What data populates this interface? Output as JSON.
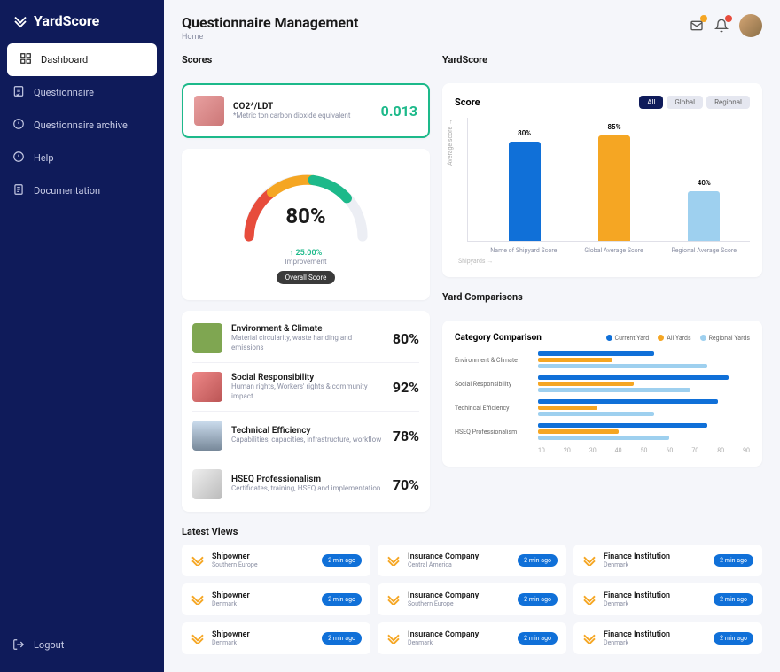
{
  "brand": "YardScore",
  "nav": {
    "items": [
      {
        "label": "Dashboard",
        "active": true
      },
      {
        "label": "Questionnaire",
        "active": false
      },
      {
        "label": "Questionnaire archive",
        "active": false
      },
      {
        "label": "Help",
        "active": false
      },
      {
        "label": "Documentation",
        "active": false
      }
    ],
    "logout": "Logout"
  },
  "header": {
    "title": "Questionnaire Management",
    "breadcrumb": "Home"
  },
  "sections": {
    "scores": "Scores",
    "yardscore": "YardScore",
    "comparisons": "Yard Comparisons",
    "latest_views": "Latest Views"
  },
  "co2": {
    "title": "CO2*/LDT",
    "sub": "*Metric ton carbon dioxide equivalent",
    "value": "0.013"
  },
  "gauge": {
    "value": "80%",
    "improve": "↑ 25.00%",
    "improve_label": "Improvement",
    "overall_label": "Overall Score"
  },
  "score_categories": [
    {
      "name": "Environment & Climate",
      "sub": "Material circularity, waste handing and emissions",
      "value": "80%"
    },
    {
      "name": "Social Responsibility",
      "sub": "Human rights, Workers' rights & community impact",
      "value": "92%"
    },
    {
      "name": "Technical Efficiency",
      "sub": "Capabilities, capacities, infrastructure, workflow",
      "value": "78%"
    },
    {
      "name": "HSEQ Professionalism",
      "sub": "Certificates, training, HSEQ and implementation",
      "value": "70%"
    }
  ],
  "yardscore_chart": {
    "title": "Score",
    "ylabel": "Average score →",
    "xlabel": "Shipyards →",
    "filters": [
      "All",
      "Global",
      "Regional"
    ],
    "active_filter": "All"
  },
  "chart_data": {
    "type": "bar",
    "categories": [
      "Name of Shipyard Score",
      "Global Average Score",
      "Regional Average Score"
    ],
    "values": [
      80,
      85,
      40
    ],
    "colors": [
      "#1070d8",
      "#f5a623",
      "#9ed0ef"
    ],
    "ylim": [
      0,
      100
    ],
    "yticks": [
      0,
      10,
      20,
      30,
      40,
      50,
      60,
      70,
      80,
      90,
      100
    ]
  },
  "comparison": {
    "title": "Category Comparison",
    "legend": [
      {
        "label": "Current Yard",
        "color": "#1070d8"
      },
      {
        "label": "All Yards",
        "color": "#f5a623"
      },
      {
        "label": "Regional Yards",
        "color": "#9ed0ef"
      }
    ],
    "categories": [
      "Environment & Climate",
      "Social Responsibility",
      "Techincal Efficiency",
      "HSEQ Professionalism"
    ],
    "series": [
      {
        "name": "Current Yard",
        "color": "#1070d8",
        "values": [
          55,
          90,
          85,
          80
        ]
      },
      {
        "name": "All Yards",
        "color": "#f5a623",
        "values": [
          35,
          45,
          28,
          38
        ]
      },
      {
        "name": "Regional Yards",
        "color": "#9ed0ef",
        "values": [
          80,
          72,
          55,
          62
        ]
      }
    ],
    "xticks": [
      10,
      20,
      30,
      40,
      50,
      60,
      70,
      80,
      90
    ]
  },
  "latest_views": [
    {
      "name": "Shipowner",
      "loc": "Southern Europe",
      "time": "2 min ago"
    },
    {
      "name": "Insurance Company",
      "loc": "Central America",
      "time": "2 min ago"
    },
    {
      "name": "Finance Institution",
      "loc": "Denmark",
      "time": "2 min ago"
    },
    {
      "name": "Shipowner",
      "loc": "Denmark",
      "time": "2 min ago"
    },
    {
      "name": "Insurance Company",
      "loc": "Southern Europe",
      "time": "2 min ago"
    },
    {
      "name": "Finance Institution",
      "loc": "Denmark",
      "time": "2 min ago"
    },
    {
      "name": "Shipowner",
      "loc": "Denmark",
      "time": "2 min ago"
    },
    {
      "name": "Insurance Company",
      "loc": "Denmark",
      "time": "2 min ago"
    },
    {
      "name": "Finance Institution",
      "loc": "Denmark",
      "time": "2 min ago"
    }
  ]
}
